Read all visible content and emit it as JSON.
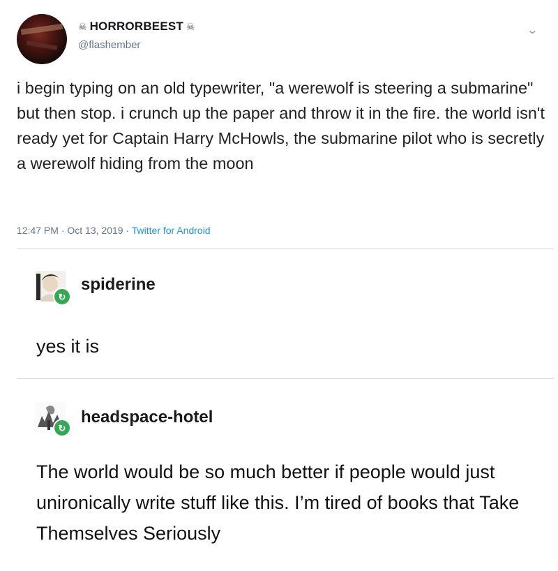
{
  "tweet": {
    "display_name": "HORRORBEEST",
    "name_emoji_left": "☠",
    "name_emoji_right": "☠",
    "handle": "@flashember",
    "text": "i begin typing on an old typewriter, \"a werewolf is steering a submarine\" but then stop. i crunch up the paper and throw it in the fire. the world isn't ready yet for Captain Harry McHowls, the submarine pilot who is secretly a werewolf hiding from the moon",
    "time": "12:47 PM",
    "date": "Oct 13, 2019",
    "client": "Twitter for Android",
    "separator": "·",
    "menu_icon": "chevron-down-icon"
  },
  "reblogs": [
    {
      "username": "spiderine",
      "text": "yes it is",
      "badge_icon": "reblog-icon"
    },
    {
      "username": "headspace-hotel",
      "text": "The world would be so much better if people would just unironically write stuff like this. I’m tired of books that Take Themselves Seriously",
      "badge_icon": "reblog-icon"
    }
  ],
  "colors": {
    "link": "#1b95e0",
    "reblog_badge": "#34a853",
    "meta": "#657786"
  }
}
